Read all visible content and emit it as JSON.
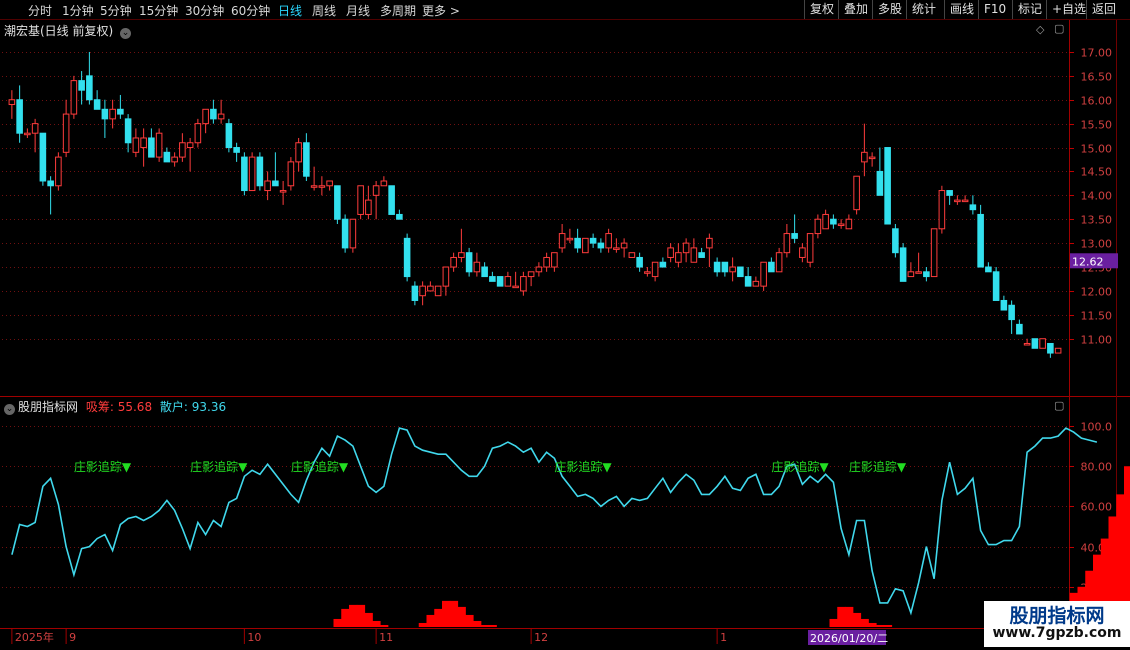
{
  "toolbar": {
    "periods": [
      "分时",
      "1分钟",
      "5分钟",
      "15分钟",
      "30分钟",
      "60分钟",
      "日线",
      "周线",
      "月线",
      "多周期",
      "更多 >"
    ],
    "active": "日线",
    "right_buttons": [
      "复权",
      "叠加",
      "多股",
      "统计",
      "画线",
      "F10",
      "标记",
      "+自选",
      "返回"
    ]
  },
  "stock_title": "潮宏基(日线 前复权)",
  "indicator": {
    "name": "股朋指标网",
    "label_a": "吸筹:",
    "value_a": "55.68",
    "label_b": "散户:",
    "value_b": "93.36"
  },
  "price_marker": "12.62",
  "date_marker": "2026/01/20/二",
  "watermark": {
    "line1": "股朋指标网",
    "line2": "www.7gpzb.com"
  },
  "colors": {
    "up": "#ff3c3c",
    "down": "#33e0ee",
    "line": "#40d8ec",
    "bar": "#ff0000",
    "signal": "#22dd22",
    "grid": "#701010"
  },
  "chart_data": [
    {
      "type": "candlestick",
      "title": "潮宏基(日线 前复权)",
      "y_ticks": [
        11.0,
        11.5,
        12.0,
        12.5,
        13.0,
        13.5,
        14.0,
        14.5,
        15.0,
        15.5,
        16.0,
        16.5,
        17.0
      ],
      "y_tick_labels": [
        "11.00",
        "11.50",
        "12.00",
        "12.50",
        "13.00",
        "13.50",
        "14.00",
        "14.50",
        "15.00",
        "15.50",
        "16.00",
        "16.50",
        "17.00"
      ],
      "ylim": [
        10.45,
        17.25
      ],
      "candles": [
        [
          15.9,
          16.2,
          15.6,
          16.0
        ],
        [
          16.0,
          16.3,
          15.1,
          15.3
        ],
        [
          15.3,
          15.4,
          15.2,
          15.3
        ],
        [
          15.3,
          15.6,
          14.9,
          15.5
        ],
        [
          15.3,
          15.3,
          14.2,
          14.3
        ],
        [
          14.3,
          14.4,
          13.6,
          14.2
        ],
        [
          14.2,
          14.9,
          14.1,
          14.8
        ],
        [
          14.9,
          16.0,
          14.8,
          15.7
        ],
        [
          15.7,
          16.5,
          15.6,
          16.4
        ],
        [
          16.4,
          16.6,
          15.9,
          16.2
        ],
        [
          16.5,
          17.0,
          15.9,
          16.0
        ],
        [
          16.0,
          16.2,
          15.8,
          15.8
        ],
        [
          15.8,
          16.0,
          15.2,
          15.6
        ],
        [
          15.6,
          16.0,
          15.4,
          15.8
        ],
        [
          15.8,
          16.1,
          15.6,
          15.7
        ],
        [
          15.6,
          15.7,
          14.9,
          15.1
        ],
        [
          14.9,
          15.4,
          14.8,
          15.2
        ],
        [
          15.0,
          15.4,
          14.6,
          15.2
        ],
        [
          15.2,
          15.4,
          14.8,
          14.8
        ],
        [
          14.8,
          15.4,
          14.7,
          15.3
        ],
        [
          14.9,
          15.0,
          14.7,
          14.7
        ],
        [
          14.7,
          14.9,
          14.6,
          14.8
        ],
        [
          14.8,
          15.3,
          14.7,
          15.1
        ],
        [
          15.0,
          15.2,
          14.5,
          15.1
        ],
        [
          15.1,
          15.6,
          15.0,
          15.5
        ],
        [
          15.5,
          15.8,
          15.3,
          15.8
        ],
        [
          15.8,
          16.0,
          15.5,
          15.6
        ],
        [
          15.6,
          16.0,
          15.5,
          15.7
        ],
        [
          15.5,
          15.6,
          14.9,
          15.0
        ],
        [
          15.0,
          15.1,
          14.7,
          14.9
        ],
        [
          14.8,
          14.9,
          14.0,
          14.1
        ],
        [
          14.1,
          14.9,
          14.1,
          14.8
        ],
        [
          14.8,
          14.9,
          14.1,
          14.2
        ],
        [
          14.1,
          14.5,
          13.9,
          14.3
        ],
        [
          14.3,
          14.9,
          14.2,
          14.2
        ],
        [
          14.1,
          14.3,
          13.8,
          14.1
        ],
        [
          14.2,
          14.8,
          14.1,
          14.7
        ],
        [
          14.7,
          15.2,
          14.5,
          15.1
        ],
        [
          15.1,
          15.3,
          14.3,
          14.4
        ],
        [
          14.2,
          14.6,
          14.1,
          14.2
        ],
        [
          14.2,
          14.4,
          14.0,
          14.2
        ],
        [
          14.2,
          14.3,
          14.1,
          14.3
        ],
        [
          14.2,
          14.2,
          13.4,
          13.5
        ],
        [
          13.5,
          13.6,
          12.8,
          12.9
        ],
        [
          12.9,
          13.5,
          12.8,
          13.5
        ],
        [
          13.6,
          14.2,
          13.5,
          14.2
        ],
        [
          13.6,
          14.2,
          13.5,
          13.9
        ],
        [
          14.0,
          14.3,
          13.5,
          14.2
        ],
        [
          14.2,
          14.4,
          14.2,
          14.3
        ],
        [
          14.2,
          14.2,
          13.6,
          13.6
        ],
        [
          13.6,
          13.7,
          13.5,
          13.5
        ],
        [
          13.1,
          13.2,
          12.2,
          12.3
        ],
        [
          12.1,
          12.2,
          11.7,
          11.8
        ],
        [
          11.9,
          12.2,
          11.7,
          12.1
        ],
        [
          12.0,
          12.2,
          12.0,
          12.1
        ],
        [
          11.9,
          12.1,
          11.9,
          12.1
        ],
        [
          12.1,
          12.5,
          11.9,
          12.5
        ],
        [
          12.5,
          12.8,
          12.4,
          12.7
        ],
        [
          12.7,
          13.3,
          12.6,
          12.8
        ],
        [
          12.8,
          12.9,
          12.3,
          12.4
        ],
        [
          12.4,
          12.8,
          12.3,
          12.6
        ],
        [
          12.5,
          12.6,
          12.3,
          12.3
        ],
        [
          12.3,
          12.4,
          12.2,
          12.2
        ],
        [
          12.3,
          12.3,
          12.1,
          12.1
        ],
        [
          12.1,
          12.4,
          12.1,
          12.3
        ],
        [
          12.1,
          12.4,
          12.1,
          12.1
        ],
        [
          12.0,
          12.4,
          11.9,
          12.3
        ],
        [
          12.3,
          12.4,
          12.1,
          12.4
        ],
        [
          12.4,
          12.6,
          12.3,
          12.5
        ],
        [
          12.5,
          12.8,
          12.4,
          12.7
        ],
        [
          12.5,
          12.8,
          12.4,
          12.8
        ],
        [
          12.9,
          13.4,
          12.8,
          13.2
        ],
        [
          13.1,
          13.3,
          13.0,
          13.1
        ],
        [
          13.1,
          13.3,
          12.8,
          12.9
        ],
        [
          12.8,
          13.1,
          12.8,
          13.1
        ],
        [
          13.1,
          13.2,
          12.9,
          13.0
        ],
        [
          13.0,
          13.1,
          12.8,
          12.9
        ],
        [
          12.9,
          13.3,
          12.8,
          13.2
        ],
        [
          12.9,
          13.1,
          12.8,
          12.9
        ],
        [
          12.9,
          13.1,
          12.7,
          13.0
        ],
        [
          12.7,
          12.8,
          12.7,
          12.8
        ],
        [
          12.7,
          12.8,
          12.4,
          12.5
        ],
        [
          12.4,
          12.5,
          12.3,
          12.4
        ],
        [
          12.3,
          12.6,
          12.2,
          12.6
        ],
        [
          12.6,
          12.7,
          12.5,
          12.5
        ],
        [
          12.7,
          13.0,
          12.6,
          12.9
        ],
        [
          12.6,
          13.0,
          12.5,
          12.8
        ],
        [
          12.8,
          13.1,
          12.6,
          13.0
        ],
        [
          12.6,
          13.1,
          12.6,
          12.9
        ],
        [
          12.8,
          12.9,
          12.7,
          12.7
        ],
        [
          12.9,
          13.2,
          12.5,
          13.1
        ],
        [
          12.6,
          12.7,
          12.3,
          12.4
        ],
        [
          12.6,
          12.6,
          12.3,
          12.4
        ],
        [
          12.4,
          12.7,
          12.2,
          12.5
        ],
        [
          12.5,
          12.5,
          12.3,
          12.3
        ],
        [
          12.3,
          12.5,
          12.1,
          12.1
        ],
        [
          12.1,
          12.3,
          12.1,
          12.2
        ],
        [
          12.1,
          12.6,
          12.0,
          12.6
        ],
        [
          12.6,
          12.7,
          12.4,
          12.4
        ],
        [
          12.4,
          12.9,
          12.4,
          12.8
        ],
        [
          12.8,
          13.4,
          12.7,
          13.2
        ],
        [
          13.2,
          13.6,
          13.0,
          13.1
        ],
        [
          12.7,
          13.0,
          12.6,
          12.9
        ],
        [
          12.6,
          13.2,
          12.5,
          13.2
        ],
        [
          13.2,
          13.6,
          13.1,
          13.5
        ],
        [
          13.3,
          13.7,
          13.3,
          13.6
        ],
        [
          13.5,
          13.6,
          13.3,
          13.4
        ],
        [
          13.4,
          13.5,
          13.3,
          13.4
        ],
        [
          13.3,
          13.6,
          13.3,
          13.5
        ],
        [
          13.7,
          14.4,
          13.6,
          14.4
        ],
        [
          14.7,
          15.5,
          14.4,
          14.9
        ],
        [
          14.8,
          14.9,
          14.6,
          14.8
        ],
        [
          14.5,
          15.0,
          14.3,
          14.0
        ],
        [
          15.0,
          15.0,
          13.4,
          13.4
        ],
        [
          13.3,
          13.4,
          12.7,
          12.8
        ],
        [
          12.9,
          13.0,
          12.2,
          12.2
        ],
        [
          12.3,
          12.6,
          12.3,
          12.4
        ],
        [
          12.4,
          12.8,
          12.4,
          12.4
        ],
        [
          12.4,
          12.5,
          12.2,
          12.3
        ],
        [
          12.3,
          13.2,
          12.3,
          13.3
        ],
        [
          13.3,
          14.2,
          13.2,
          14.1
        ],
        [
          14.1,
          14.1,
          13.8,
          14.0
        ],
        [
          13.9,
          14.0,
          13.8,
          13.9
        ],
        [
          13.9,
          14.0,
          13.9,
          13.9
        ],
        [
          13.8,
          14.0,
          13.6,
          13.7
        ],
        [
          13.6,
          13.8,
          12.5,
          12.5
        ],
        [
          12.5,
          12.6,
          12.4,
          12.4
        ],
        [
          12.4,
          12.5,
          11.8,
          11.8
        ],
        [
          11.8,
          11.9,
          11.6,
          11.6
        ],
        [
          11.7,
          11.8,
          11.1,
          11.4
        ],
        [
          11.3,
          11.4,
          11.1,
          11.1
        ],
        [
          10.9,
          11.0,
          10.9,
          10.9
        ],
        [
          11.0,
          11.0,
          10.8,
          10.8
        ],
        [
          10.8,
          11.0,
          10.8,
          11.0
        ],
        [
          10.9,
          10.9,
          10.6,
          10.7
        ],
        [
          10.7,
          10.8,
          10.7,
          10.8
        ]
      ]
    },
    {
      "type": "line",
      "title": "股朋指标网",
      "y_ticks": [
        20,
        40,
        60,
        80,
        100
      ],
      "y_tick_labels": [
        "20.00",
        "40.00",
        "60.00",
        "80.00",
        "100.0"
      ],
      "ylim": [
        0,
        105
      ],
      "series": [
        {
          "name": "散户",
          "values": [
            36,
            51,
            50,
            52,
            70,
            74,
            61,
            40,
            26,
            39,
            40,
            44,
            46,
            38,
            51,
            54,
            55,
            53,
            55,
            58,
            63,
            58,
            49,
            39,
            52,
            46,
            53,
            50,
            62,
            64,
            75,
            78,
            76,
            81,
            76,
            71,
            66,
            62,
            73,
            82,
            89,
            85,
            95,
            93,
            90,
            80,
            70,
            67,
            70,
            86,
            99,
            98,
            90,
            88,
            87,
            86,
            86,
            82,
            78,
            75,
            75,
            80,
            89,
            90,
            92,
            90,
            87,
            89,
            82,
            87,
            84,
            75,
            70,
            65,
            66,
            64,
            60,
            63,
            65,
            60,
            64,
            63,
            64,
            69,
            74,
            67,
            72,
            76,
            73,
            66,
            66,
            70,
            75,
            69,
            68,
            74,
            76,
            66,
            66,
            70,
            80,
            81,
            71,
            75,
            72,
            76,
            72,
            49,
            36,
            53,
            53,
            28,
            12,
            12,
            19,
            18,
            7,
            22,
            40,
            24,
            63,
            82,
            66,
            69,
            74,
            48,
            41,
            41,
            43,
            43,
            50,
            87,
            90,
            94,
            94,
            95,
            99,
            97,
            94,
            93,
            92
          ]
        },
        {
          "name": "吸筹",
          "values": [
            0,
            0,
            0,
            0,
            0,
            0,
            0,
            0,
            0,
            0,
            0,
            0,
            0,
            0,
            0,
            0,
            0,
            0,
            0,
            0,
            0,
            0,
            0,
            0,
            0,
            0,
            0,
            0,
            0,
            0,
            0,
            0,
            0,
            0,
            0,
            0,
            0,
            0,
            0,
            0,
            0,
            0,
            4,
            9,
            11,
            11,
            7,
            3,
            1,
            0,
            0,
            0,
            0,
            2,
            6,
            9,
            13,
            13,
            10,
            6,
            3,
            1,
            1,
            0,
            0,
            0,
            0,
            0,
            0,
            0,
            0,
            0,
            0,
            0,
            0,
            0,
            0,
            0,
            0,
            0,
            0,
            0,
            0,
            0,
            0,
            0,
            0,
            0,
            0,
            0,
            0,
            0,
            0,
            0,
            0,
            0,
            0,
            0,
            0,
            0,
            0,
            0,
            0,
            0,
            0,
            0,
            4,
            10,
            10,
            7,
            4,
            2,
            1,
            1,
            0,
            0,
            0,
            0,
            0,
            0,
            0,
            0,
            0,
            0,
            0,
            0,
            0,
            0,
            0,
            0,
            0,
            0,
            0,
            0,
            0,
            0,
            10,
            17,
            20,
            28,
            36,
            44,
            55,
            66,
            80,
            89,
            100,
            100,
            100,
            56
          ]
        }
      ],
      "signals": [
        {
          "label": "庄影追踪▼",
          "index": 8
        },
        {
          "label": "庄影追踪▼",
          "index": 23
        },
        {
          "label": "庄影追踪▼",
          "index": 36
        },
        {
          "label": "庄影追踪▼",
          "index": 70
        },
        {
          "label": "庄影追踪▼",
          "index": 98
        },
        {
          "label": "庄影追踪▼",
          "index": 108
        }
      ]
    }
  ],
  "x_axis": {
    "labels": [
      {
        "text": "2025年",
        "index": 0
      },
      {
        "text": "9",
        "index": 7
      },
      {
        "text": "10",
        "index": 30
      },
      {
        "text": "11",
        "index": 47
      },
      {
        "text": "12",
        "index": 67
      },
      {
        "text": "1",
        "index": 91
      }
    ]
  }
}
